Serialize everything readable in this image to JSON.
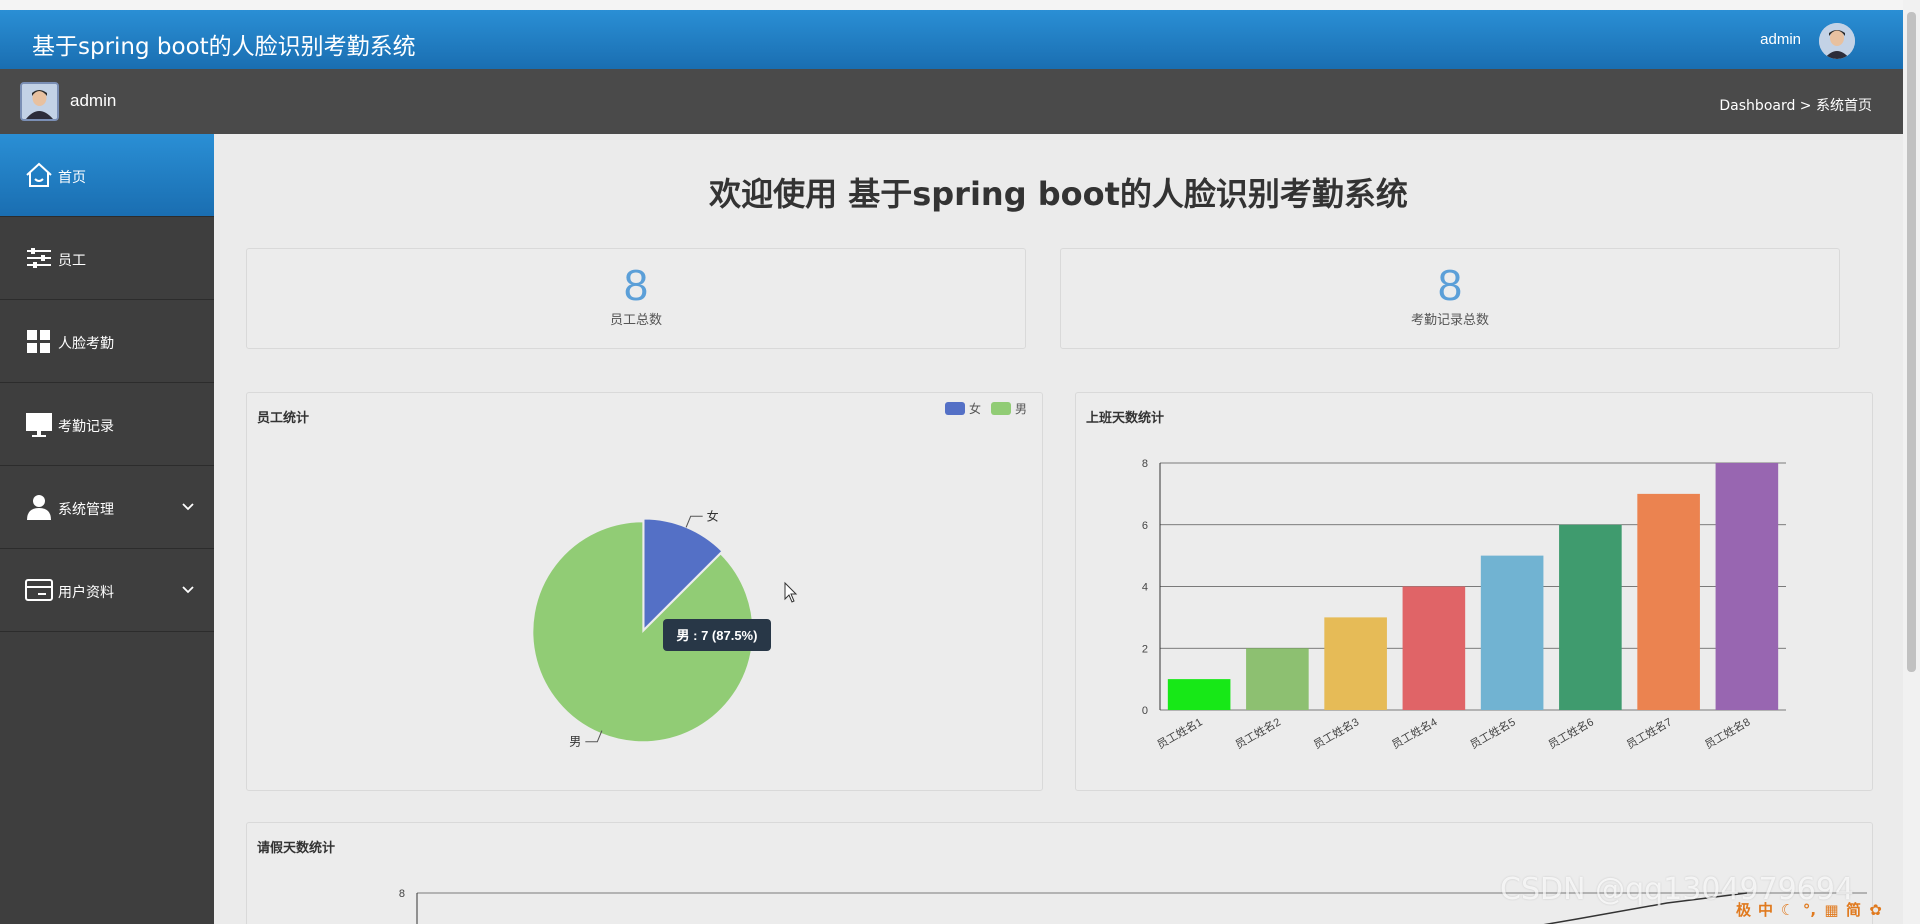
{
  "header": {
    "app_title": "基于spring boot的人脸识别考勤系统",
    "user_name": "admin"
  },
  "subbar": {
    "user_name": "admin",
    "breadcrumb": "Dashboard > 系统首页"
  },
  "sidebar": {
    "items": [
      {
        "label": "首页",
        "icon": "home-icon",
        "active": true
      },
      {
        "label": "员工",
        "icon": "sliders-icon"
      },
      {
        "label": "人脸考勤",
        "icon": "grid-icon"
      },
      {
        "label": "考勤记录",
        "icon": "monitor-icon"
      },
      {
        "label": "系统管理",
        "icon": "user-icon",
        "has_submenu": true
      },
      {
        "label": "用户资料",
        "icon": "card-icon",
        "has_submenu": true
      }
    ]
  },
  "main": {
    "page_title": "欢迎使用 基于spring boot的人脸识别考勤系统",
    "stats": [
      {
        "value": "8",
        "label": "员工总数"
      },
      {
        "value": "8",
        "label": "考勤记录总数"
      }
    ],
    "employee_chart_title": "员工统计",
    "workdays_chart_title": "上班天数统计",
    "leave_chart_title": "请假天数统计"
  },
  "colors": {
    "accent": "#1a7bc4",
    "sidebar_bg": "#3e3e3e",
    "subbar_bg": "#4a4a4a",
    "stat_number": "#5b9fd8"
  },
  "chart_data": [
    {
      "type": "pie",
      "title": "员工统计",
      "legend": [
        "女",
        "男"
      ],
      "legend_position": "top-right",
      "slices": [
        {
          "name": "女",
          "value": 1,
          "color": "#5470c6"
        },
        {
          "name": "男",
          "value": 7,
          "color": "#91cc75"
        }
      ],
      "tooltip": "男 : 7 (87.5%)"
    },
    {
      "type": "bar",
      "title": "上班天数统计",
      "categories": [
        "员工姓名1",
        "员工姓名2",
        "员工姓名3",
        "员工姓名4",
        "员工姓名5",
        "员工姓名6",
        "员工姓名7",
        "员工姓名8"
      ],
      "values": [
        1,
        2,
        3,
        4,
        5,
        6,
        7,
        8
      ],
      "colors": [
        "#17e817",
        "#8dc071",
        "#e6bb57",
        "#e06467",
        "#71b3d2",
        "#3f9b6e",
        "#eb8350",
        "#9866b1"
      ],
      "ylim": [
        0,
        8
      ],
      "yticks": [
        "0",
        "2",
        "4",
        "6",
        "8"
      ],
      "grid": true
    },
    {
      "type": "line",
      "title": "请假天数统计",
      "ylim": [
        0,
        8
      ],
      "yticks": [
        "8"
      ],
      "grid": true
    }
  ],
  "overlay": {
    "watermark": "CSDN @qq1304979694",
    "ime_glyphs": [
      "极",
      "中",
      "☾",
      "°,",
      "▦",
      "简",
      "✿"
    ]
  }
}
